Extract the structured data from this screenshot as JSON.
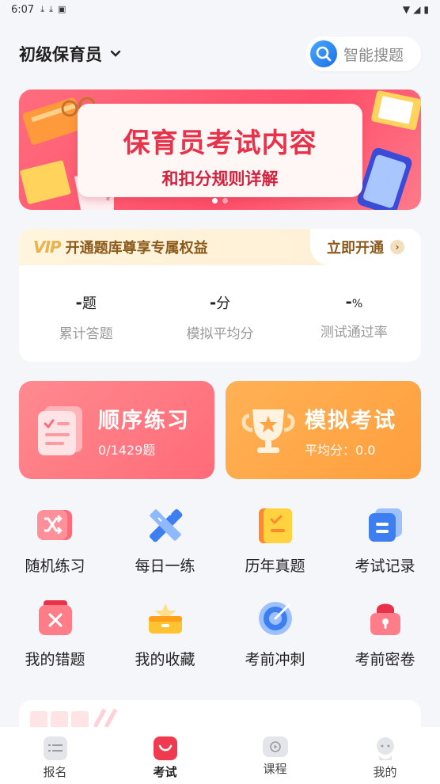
{
  "status_bar": {
    "time": "6:07"
  },
  "header": {
    "title": "初级保育员",
    "search_label": "智能搜题"
  },
  "banner": {
    "title": "保育员考试内容",
    "subtitle": "和扣分规则详解"
  },
  "vip": {
    "badge": "VIP",
    "text": "开通题库尊享专属权益",
    "open_label": "立即开通"
  },
  "stats": [
    {
      "value": "-",
      "unit": "题",
      "label": "累计答题"
    },
    {
      "value": "-",
      "unit": "分",
      "label": "模拟平均分"
    },
    {
      "value": "-",
      "unit": "%",
      "label": "测试通过率"
    }
  ],
  "cards": {
    "practice": {
      "title": "顺序练习",
      "sub": "0/1429题"
    },
    "exam": {
      "title": "模拟考试",
      "sub": "平均分：0.0"
    }
  },
  "grid": [
    {
      "label": "随机练习"
    },
    {
      "label": "每日一练"
    },
    {
      "label": "历年真题"
    },
    {
      "label": "考试记录"
    },
    {
      "label": "我的错题"
    },
    {
      "label": "我的收藏"
    },
    {
      "label": "考前冲刺"
    },
    {
      "label": "考前密卷"
    }
  ],
  "tabbar": [
    {
      "label": "报名"
    },
    {
      "label": "考试"
    },
    {
      "label": "课程"
    },
    {
      "label": "我的"
    }
  ],
  "colors": {
    "accent_red": "#ff4f6a",
    "accent_orange": "#ffa545",
    "vip_brown": "#8b5a1a",
    "tab_active": "#f03a4f"
  }
}
